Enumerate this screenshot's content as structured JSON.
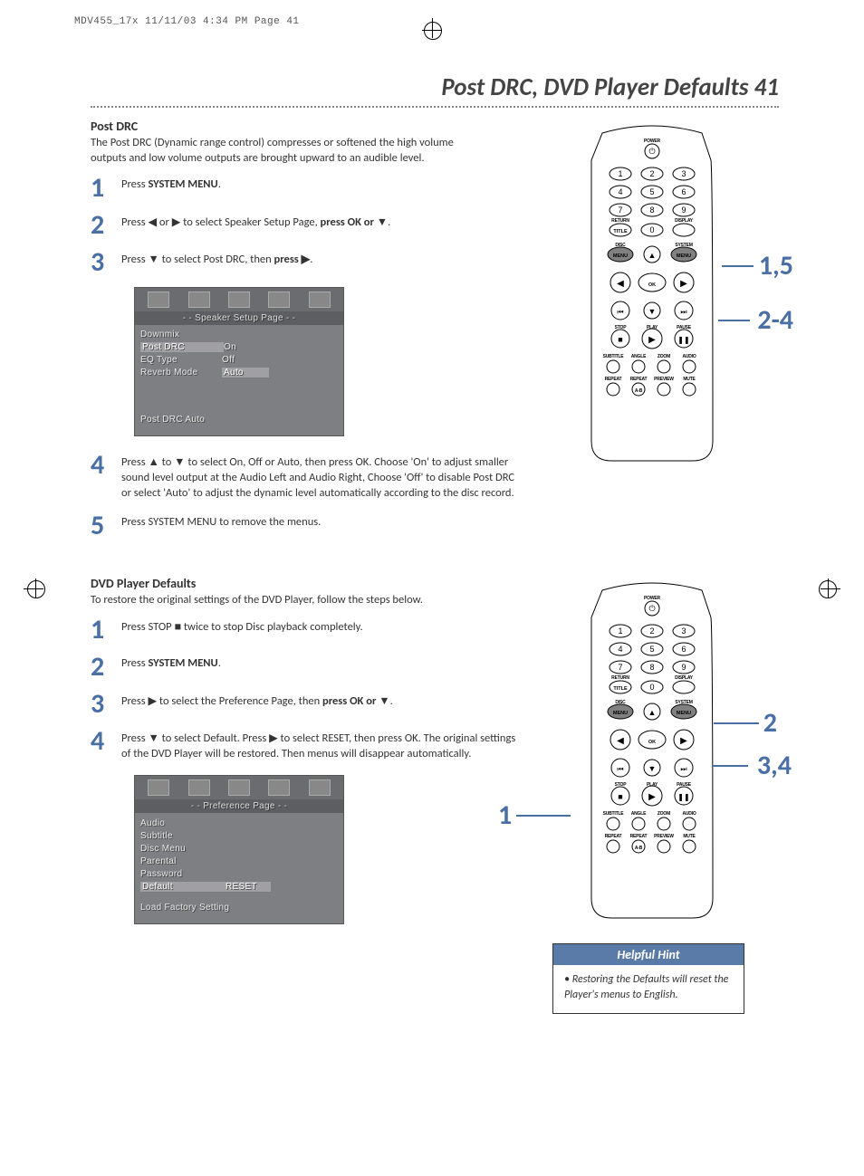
{
  "print_mark": "MDV455_17x  11/11/03  4:34 PM  Page 41",
  "page_title": "Post DRC, DVD Player Defaults  41",
  "section_a": {
    "heading": "Post DRC",
    "intro": "The Post DRC (Dynamic range control) compresses or softened the high volume outputs and low volume outputs are brought upward to an audible level.",
    "steps": [
      {
        "num": "1",
        "html": "Press <b>SYSTEM MENU</b>."
      },
      {
        "num": "2",
        "html": "Press <span class='arrow'>◀</span> or <span class='arrow'>▶</span> to select Speaker Setup Page, <b>press OK or <span class='arrow'>▼</span></b>."
      },
      {
        "num": "3",
        "html": "Press <span class='arrow'>▼</span> to select Post DRC, then <b>press <span class='arrow'>▶</span></b>."
      },
      {
        "num": "4",
        "html": "Press <span class='arrow'>▲</span> to <span class='arrow'>▼</span> to select On, Off or Auto, then press OK. Choose 'On' to adjust smaller sound level output at the Audio Left and Audio Right, Choose 'Off' to disable Post DRC or select 'Auto' to adjust the dynamic level automatically according to the disc record."
      },
      {
        "num": "5",
        "html": "Press SYSTEM MENU to remove the menus."
      }
    ],
    "osd": {
      "title": "- -   Speaker Setup Page   - -",
      "rows": [
        {
          "k": "Downmix",
          "v": ""
        },
        {
          "k": "Post DRC",
          "v": "On",
          "sel": true
        },
        {
          "k": "EQ Type",
          "v": "Off"
        },
        {
          "k": "Reverb Mode",
          "v": "Auto",
          "selv": true
        }
      ],
      "footer": "Post DRC Auto"
    },
    "callouts": [
      "1,5",
      "2-4"
    ]
  },
  "section_b": {
    "heading": "DVD Player Defaults",
    "intro": "To restore the original settings of the DVD Player, follow the steps below.",
    "steps": [
      {
        "num": "1",
        "html": "Press STOP <span style='font-family:Arial'>■</span> twice to stop Disc playback completely."
      },
      {
        "num": "2",
        "html": "Press <b>SYSTEM MENU</b>."
      },
      {
        "num": "3",
        "html": "Press <span class='arrow'>▶</span> to select the Preference Page, then <b>press OK or <span class='arrow'>▼</span></b>."
      },
      {
        "num": "4",
        "html": "Press <span class='arrow'>▼</span> to select Default. Press <span class='arrow'>▶</span> to select RESET, then press OK. The original settings of the DVD Player will be restored. Then menus will disappear automatically."
      }
    ],
    "osd": {
      "title": "- -   Preference Page   - -",
      "rows": [
        {
          "k": "Audio",
          "v": ""
        },
        {
          "k": "Subtitle",
          "v": ""
        },
        {
          "k": "Disc Menu",
          "v": ""
        },
        {
          "k": "Parental",
          "v": ""
        },
        {
          "k": "Password",
          "v": ""
        },
        {
          "k": "Default",
          "v": "RESET",
          "sel": true,
          "selv": true
        }
      ],
      "footer": "Load Factory Setting"
    },
    "callouts": [
      "2",
      "3,4",
      "1"
    ]
  },
  "hint": {
    "heading": "Helpful Hint",
    "body": "Restoring the Defaults will reset the Player's menus to English."
  },
  "remote": {
    "power": "POWER",
    "return": "RETURN",
    "display": "DISPLAY",
    "title": "TITLE",
    "disc": "DISC",
    "system": "SYSTEM",
    "menu_l": "MENU",
    "menu_r": "MENU",
    "ok": "OK",
    "stop": "STOP",
    "play": "PLAY",
    "pause": "PAUSE",
    "row1": [
      "SUBTITLE",
      "ANGLE",
      "ZOOM",
      "AUDIO"
    ],
    "row2": [
      "REPEAT",
      "REPEAT",
      "PREVIEW",
      "MUTE"
    ],
    "ab": "A-B"
  }
}
